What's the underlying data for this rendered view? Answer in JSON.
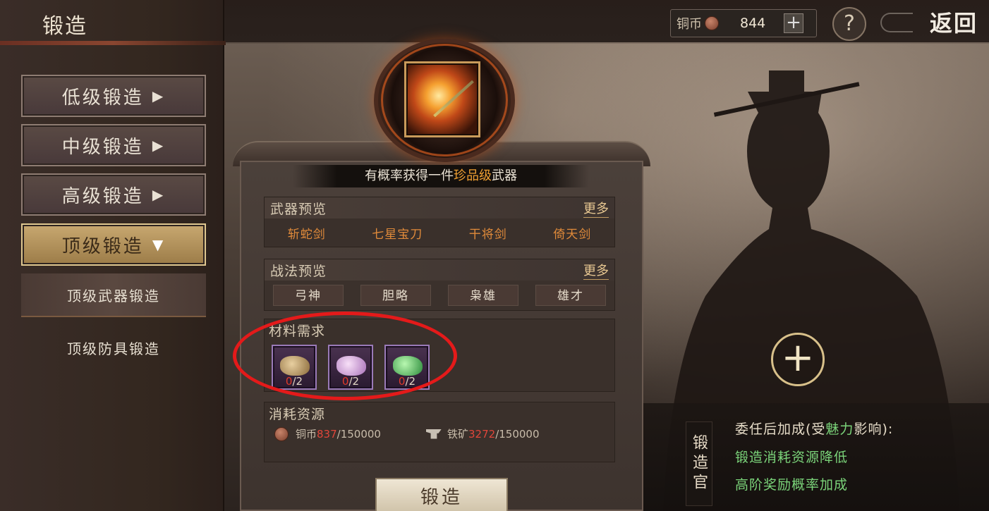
{
  "header": {
    "title": "锻造",
    "currency_label": "铜币",
    "currency_amount": "844",
    "add_symbol": "+",
    "help_symbol": "?",
    "back_label": "返回"
  },
  "menu": {
    "items": [
      {
        "label": "低级锻造",
        "arrow": "▶"
      },
      {
        "label": "中级锻造",
        "arrow": "▶"
      },
      {
        "label": "高级锻造",
        "arrow": "▶"
      },
      {
        "label": "顶级锻造",
        "arrow": "▼"
      }
    ],
    "sub_items": [
      {
        "label": "顶级武器锻造"
      },
      {
        "label": "顶级防具锻造"
      }
    ]
  },
  "forge": {
    "banner_prefix": "有概率获得一件",
    "banner_highlight": "珍品级",
    "banner_suffix": "武器",
    "weapon_section_title": "武器预览",
    "weapon_more": "更多",
    "weapons": [
      "斩蛇剑",
      "七星宝刀",
      "干将剑",
      "倚天剑"
    ],
    "tactic_section_title": "战法预览",
    "tactic_more": "更多",
    "tactics": [
      "弓神",
      "胆略",
      "枭雄",
      "雄才"
    ],
    "materials_title": "材料需求",
    "materials": [
      {
        "have": "0",
        "need": "/2",
        "color": "#b89a6a"
      },
      {
        "have": "0",
        "need": "/2",
        "color": "#d8a8d8"
      },
      {
        "have": "0",
        "need": "/2",
        "color": "#4ac85a"
      }
    ],
    "resources_title": "消耗资源",
    "resources": [
      {
        "label": "铜币",
        "have": "837",
        "need": "/150000"
      },
      {
        "label": "铁矿",
        "have": "3272",
        "need": "/150000"
      }
    ],
    "forge_button": "锻造"
  },
  "official": {
    "tag": "锻造官",
    "add_symbol": "+",
    "head_prefix": "委任后加成(受",
    "head_highlight": "魅力",
    "head_suffix": "影响):",
    "bonus_1": "锻造消耗资源降低",
    "bonus_2": "高阶奖励概率加成"
  },
  "colors": {
    "highlight_orange": "#f0a032",
    "weapon_orange": "#e08a3a",
    "bonus_green": "#7bd47a",
    "annotation_red": "#e41a1a"
  }
}
